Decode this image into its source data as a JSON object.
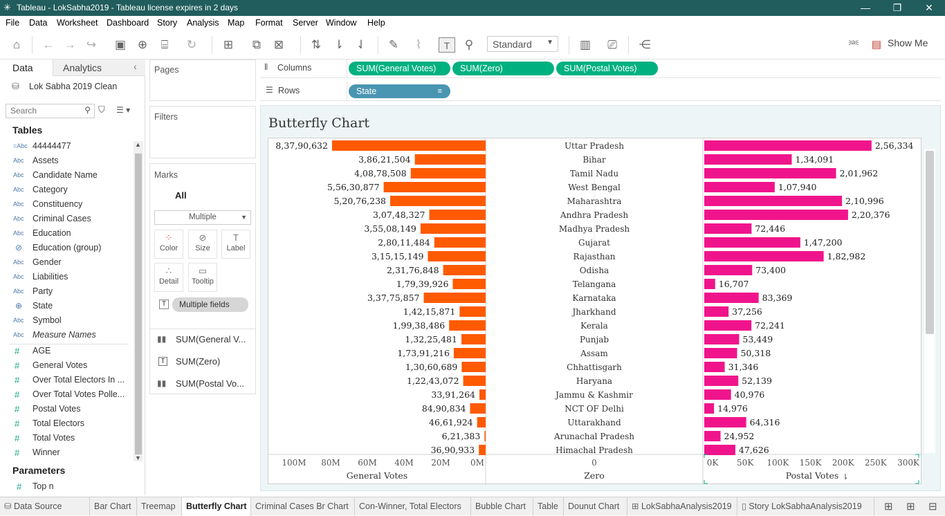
{
  "window": {
    "title": "Tableau - LokSabha2019 - Tableau license expires in 2 days"
  },
  "menu": [
    "File",
    "Data",
    "Worksheet",
    "Dashboard",
    "Story",
    "Analysis",
    "Map",
    "Format",
    "Server",
    "Window",
    "Help"
  ],
  "toolbar": {
    "fit_select": "Standard",
    "show_me": "Show Me"
  },
  "data_pane": {
    "tab_data": "Data",
    "tab_analytics": "Analytics",
    "datasource": "Lok Sabha 2019 Clean",
    "search_placeholder": "Search",
    "tables_header": "Tables",
    "dimensions": [
      {
        "label": "44444477",
        "type": "=Abc"
      },
      {
        "label": "Assets",
        "type": "Abc"
      },
      {
        "label": "Candidate Name",
        "type": "Abc"
      },
      {
        "label": "Category",
        "type": "Abc"
      },
      {
        "label": "Constituency",
        "type": "Abc"
      },
      {
        "label": "Criminal Cases",
        "type": "Abc"
      },
      {
        "label": "Education",
        "type": "Abc"
      },
      {
        "label": "Education (group)",
        "type": "@"
      },
      {
        "label": "Gender",
        "type": "Abc"
      },
      {
        "label": "Liabilities",
        "type": "Abc"
      },
      {
        "label": "Party",
        "type": "Abc"
      },
      {
        "label": "State",
        "type": "globe"
      },
      {
        "label": "Symbol",
        "type": "Abc"
      },
      {
        "label": "Measure Names",
        "type": "Abc"
      }
    ],
    "measures": [
      "AGE",
      "General Votes",
      "Over Total Electors  In ...",
      "Over Total Votes Polle...",
      "Postal Votes",
      "Total Electors",
      "Total Votes",
      "Winner"
    ],
    "parameters_header": "Parameters",
    "parameters": [
      "Top n"
    ]
  },
  "shelves": {
    "pages": "Pages",
    "filters": "Filters",
    "marks": "Marks",
    "marks_all": "All",
    "mark_type": "Multiple",
    "mark_buttons": [
      "Color",
      "Size",
      "Label",
      "Detail",
      "Tooltip"
    ],
    "multiple_fields": "Multiple fields",
    "mark_cards": [
      "SUM(General V...",
      "SUM(Zero)",
      "SUM(Postal Vo..."
    ],
    "columns_label": "Columns",
    "rows_label": "Rows",
    "columns_pills": [
      "SUM(General Votes)",
      "SUM(Zero)",
      "SUM(Postal Votes)"
    ],
    "rows_pill": "State"
  },
  "sheet_title": "Butterfly Chart",
  "chart_data": {
    "type": "bar",
    "title": "Butterfly Chart",
    "categories": [
      "Uttar Pradesh",
      "Bihar",
      "Tamil Nadu",
      "West Bengal",
      "Maharashtra",
      "Andhra Pradesh",
      "Madhya Pradesh",
      "Gujarat",
      "Rajasthan",
      "Odisha",
      "Telangana",
      "Karnataka",
      "Jharkhand",
      "Kerala",
      "Punjab",
      "Assam",
      "Chhattisgarh",
      "Haryana",
      "Jammu & Kashmir",
      "NCT OF Delhi",
      "Uttarakhand",
      "Arunachal Pradesh",
      "Himachal Pradesh"
    ],
    "series": [
      {
        "name": "General Votes",
        "color": "#ff5a00",
        "values": [
          83790632,
          38621504,
          40878508,
          55630877,
          52076238,
          30748327,
          35508149,
          28011484,
          31515149,
          23176848,
          17939926,
          33775857,
          14215871,
          19938486,
          13225481,
          17391216,
          13060689,
          12243072,
          3391264,
          8490834,
          4661924,
          621383,
          3690933
        ],
        "labels": [
          "8,37,90,632",
          "3,86,21,504",
          "4,08,78,508",
          "5,56,30,877",
          "5,20,76,238",
          "3,07,48,327",
          "3,55,08,149",
          "2,80,11,484",
          "3,15,15,149",
          "2,31,76,848",
          "1,79,39,926",
          "3,37,75,857",
          "1,42,15,871",
          "1,99,38,486",
          "1,32,25,481",
          "1,73,91,216",
          "1,30,60,689",
          "1,22,43,072",
          "33,91,264",
          "84,90,834",
          "46,61,924",
          "6,21,383",
          "36,90,933"
        ]
      },
      {
        "name": "Postal Votes",
        "color": "#f0148c",
        "values": [
          256334,
          134091,
          201962,
          107940,
          210996,
          220376,
          72446,
          147200,
          182982,
          73400,
          16707,
          83369,
          37256,
          72241,
          53449,
          50318,
          31346,
          52139,
          40976,
          14976,
          64316,
          24952,
          47626
        ],
        "labels": [
          "2,56,334",
          "1,34,091",
          "2,01,962",
          "1,07,940",
          "2,10,996",
          "2,20,376",
          "72,446",
          "1,47,200",
          "1,82,982",
          "73,400",
          "16,707",
          "83,369",
          "37,256",
          "72,241",
          "53,449",
          "50,318",
          "31,346",
          "52,139",
          "40,976",
          "14,976",
          "64,316",
          "24,952",
          "47,626"
        ]
      }
    ],
    "general_axis": {
      "label": "General Votes",
      "ticks": [
        "100M",
        "80M",
        "60M",
        "40M",
        "20M",
        "0M"
      ],
      "tick_values": [
        100000000,
        80000000,
        60000000,
        40000000,
        20000000,
        0
      ],
      "reversed": true
    },
    "zero_axis": {
      "label": "Zero",
      "ticks": [
        "0"
      ]
    },
    "postal_axis": {
      "label": "Postal Votes",
      "ticks": [
        "0K",
        "50K",
        "100K",
        "150K",
        "200K",
        "250K",
        "300K"
      ],
      "tick_values": [
        0,
        50000,
        100000,
        150000,
        200000,
        250000,
        300000
      ]
    }
  },
  "bottom_tabs": [
    "Data Source",
    "Bar Chart",
    "Treemap",
    "Butterfly Chart",
    "Criminal Cases Br Chart",
    "Con-Winner, Total Electors",
    "Bubble Chart",
    "Table",
    "Dounut Chart",
    "LokSabhaAnalysis2019",
    "Story LokSabhaAnalysis2019"
  ],
  "active_tab": "Butterfly Chart"
}
